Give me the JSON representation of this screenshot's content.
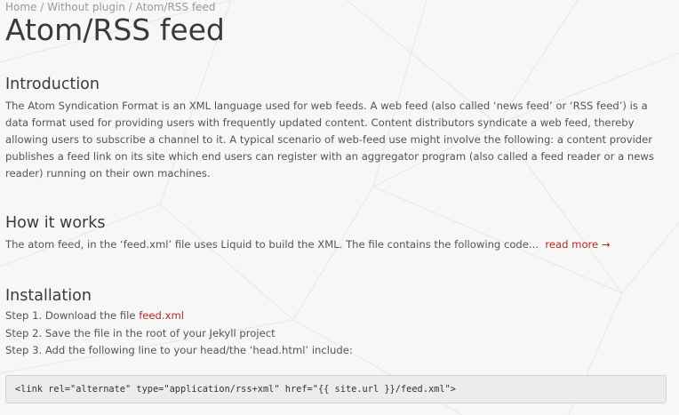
{
  "breadcrumb": {
    "items": [
      "Home",
      "Without plugin",
      "Atom/RSS feed"
    ],
    "separator": "/"
  },
  "page": {
    "title": "Atom/RSS feed"
  },
  "sections": {
    "introduction": {
      "heading": "Introduction",
      "text": "The Atom Syndication Format is an XML language used for web feeds. A web feed (also called ‘news feed’ or ‘RSS feed’) is a data format used for providing users with frequently updated content. Content distributors syndicate a web feed, thereby allowing users to subscribe a channel to it. A typical scenario of web-feed use might involve the following: a content provider publishes a feed link on its site which end users can register with an aggregator program (also called a feed reader or a news reader) running on their own machines."
    },
    "how_it_works": {
      "heading": "How it works",
      "text": "The atom feed, in the ‘feed.xml’ file uses Liquid to build the XML. The file contains the following code...",
      "read_more": "read more →"
    },
    "installation": {
      "heading": "Installation",
      "step1_prefix": "Step 1. Download the file ",
      "step1_link": "feed.xml",
      "step2": "Step 2. Save the file in the root of your Jekyll project",
      "step3": "Step 3. Add the following line to your head/the ‘head.html’ include:",
      "code": "<link rel=\"alternate\" type=\"application/rss+xml\" href=\"{{ site.url }}/feed.xml\">"
    }
  },
  "colors": {
    "background": "#f7f7f7",
    "link": "#b22a22",
    "heading": "#3a3a3a",
    "text": "#555555",
    "muted": "#9a9a9a"
  }
}
